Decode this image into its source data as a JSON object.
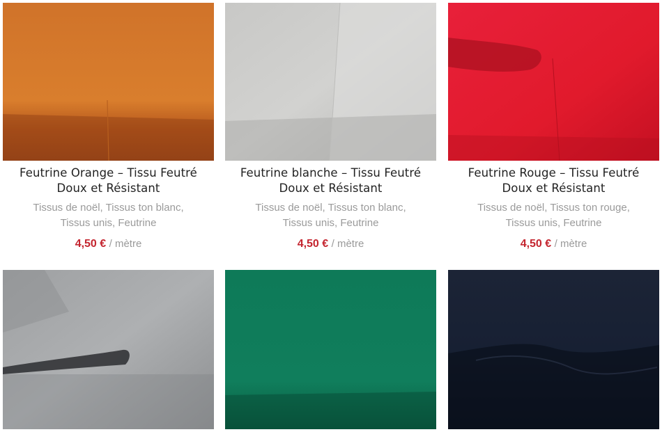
{
  "products": [
    {
      "name": "Feutrine Orange – Tissu Feutré Doux et Résistant",
      "title_line1": "Feutrine Orange – Tissu Feutré",
      "title_line2": "Doux et Résistant",
      "categories": [
        "Tissus de noël",
        "Tissus ton blanc",
        "Tissus unis",
        "Feutrine"
      ],
      "price": "4,50 €",
      "unit": "/ mètre",
      "color": "#d67a2a"
    },
    {
      "name": "Feutrine blanche – Tissu Feutré Doux et Résistant",
      "title_line1": "Feutrine blanche – Tissu Feutré",
      "title_line2": "Doux et Résistant",
      "categories": [
        "Tissus de noël",
        "Tissus ton blanc",
        "Tissus unis",
        "Feutrine"
      ],
      "price": "4,50 €",
      "unit": "/ mètre",
      "color": "#cfcfcd"
    },
    {
      "name": "Feutrine Rouge – Tissu Feutré Doux et Résistant",
      "title_line1": "Feutrine Rouge – Tissu Feutré",
      "title_line2": "Doux et Résistant",
      "categories": [
        "Tissus de noël",
        "Tissus ton rouge",
        "Tissus unis",
        "Feutrine"
      ],
      "price": "4,50 €",
      "unit": "/ mètre",
      "color": "#e41b2b"
    },
    {
      "color": "#a7a9ab"
    },
    {
      "color": "#0f7a5a"
    },
    {
      "color": "#141c2e"
    }
  ]
}
